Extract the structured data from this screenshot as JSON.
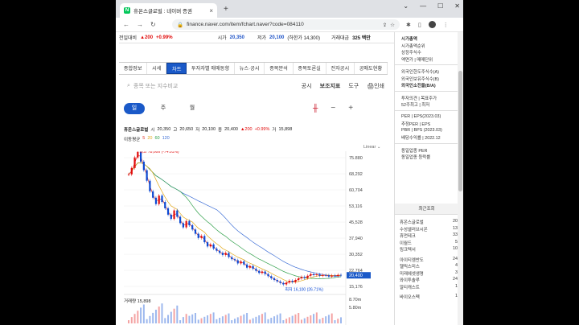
{
  "browser": {
    "tab_title": "휴온스글로벌 : 네이버 증권",
    "url": "finance.naver.com/item/fchart.naver?code=084110"
  },
  "ticker": {
    "prev_label": "전일대비",
    "change": "▲200",
    "change_pct": "+0.99%",
    "open_label": "시가",
    "open_value": "20,350",
    "low_label": "저가",
    "low_value": "20,100",
    "limit_down": "(하한가 14,300)",
    "volume_label": "거래대금",
    "volume_value": "325 백만"
  },
  "tabs": [
    "종합정보",
    "시세",
    "차트",
    "투자자별 매매동향",
    "뉴스·공시",
    "종목분석",
    "종목토론실",
    "전자공시",
    "공매도현황"
  ],
  "tools": {
    "search_placeholder": "종목 또는 지수비교",
    "btn1": "공시",
    "btn2": "보조지표",
    "btn3": "도구",
    "btn4": "인쇄"
  },
  "periods": [
    "일",
    "주",
    "월"
  ],
  "info": {
    "name": "휴온스글로벌",
    "o_label": "시",
    "o": "20,350",
    "h_label": "고",
    "h": "20,650",
    "l_label": "저",
    "l": "20,100",
    "c_label": "종",
    "c": "20,400",
    "chg": "▲200",
    "pct": "+0.99%",
    "v_label": "거",
    "v": "15,898"
  },
  "ma": {
    "label": "이동평균",
    "p5": "5",
    "p20": "20",
    "p60": "60",
    "p120": "120"
  },
  "linear": "Linear ⌄",
  "volume_label": "거래량 15,898",
  "chart_data": {
    "type": "line",
    "yticks": [
      75880,
      68292,
      60704,
      53116,
      45528,
      37940,
      30352,
      22764,
      15176
    ],
    "ytick_labels": [
      "75.880",
      "68,292",
      "60,704",
      "53,116",
      "45,528",
      "37,940",
      "30,352",
      "22,764",
      "15,176"
    ],
    "vol_ticks": [
      "8.70m",
      "5.80m"
    ],
    "current_label": "20,400",
    "current": 20400,
    "ylim": [
      15176,
      75880
    ],
    "max_label": "최고 78,606 (-74.01%)",
    "min_label": "최저 16,100 (26.71%)",
    "max": 78606,
    "min": 16100,
    "price": [
      68000,
      71000,
      76000,
      78606,
      74000,
      70000,
      65000,
      60000,
      57000,
      54000,
      58000,
      55000,
      52000,
      49000,
      47000,
      51000,
      48000,
      45000,
      43000,
      46000,
      44000,
      42000,
      40000,
      38000,
      39000,
      36000,
      34000,
      35000,
      33000,
      32000,
      31000,
      30000,
      31000,
      29000,
      28000,
      27500,
      26000,
      27000,
      25500,
      24000,
      24800,
      23500,
      22500,
      21500,
      22200,
      21000,
      20000,
      19000,
      18200,
      17500,
      16800,
      16100,
      17000,
      17800,
      17200,
      18200,
      19000,
      19600,
      19100,
      20200,
      21000,
      20500,
      20800,
      20200,
      20500,
      20400,
      19800,
      20300,
      20100,
      20600,
      20400
    ],
    "colors": {
      "price": "#555555",
      "ma5": "#e0332a",
      "ma20": "#e2aa1c",
      "ma60": "#30a04a",
      "ma120": "#3e6fd6",
      "up": "#e10d0d",
      "down": "#0c4ad4",
      "accent": "#1a59c8"
    }
  },
  "sidebar": {
    "lines": [
      "시가총액",
      "시가총액순위",
      "상장주식수",
      "액면가 | 매매단위",
      "",
      "외국인한도주식수(A)",
      "외국인보유주식수(B)",
      "외국인소진율(B/A)",
      "",
      "투자의견 | 목표주가",
      "52주최고 | 최저",
      "",
      "PER | EPS(2023.03)",
      "추정PER | EPS",
      "PBR | BPS (2023.03)",
      "배당수익률 | 2022.12",
      "",
      "동일업종 PER",
      "동일업종 등락률"
    ],
    "recent_title": "최근조회",
    "recent": [
      [
        "휴온스글로벌",
        "20"
      ],
      [
        "수성샐러브시온",
        "13"
      ],
      [
        "휴먼테크",
        "33"
      ],
      [
        "이월드",
        "5"
      ],
      [
        "링크텍서",
        "10"
      ],
      [
        "",
        ""
      ],
      [
        "아이티엠반도",
        "24"
      ],
      [
        "헬릭스미스",
        "4"
      ],
      [
        "미래에셋생명",
        "3"
      ],
      [
        "와이투솔루",
        "24"
      ],
      [
        "알티캐스트",
        "1"
      ],
      [
        "",
        ""
      ],
      [
        "바이오스펙",
        "1"
      ]
    ]
  }
}
